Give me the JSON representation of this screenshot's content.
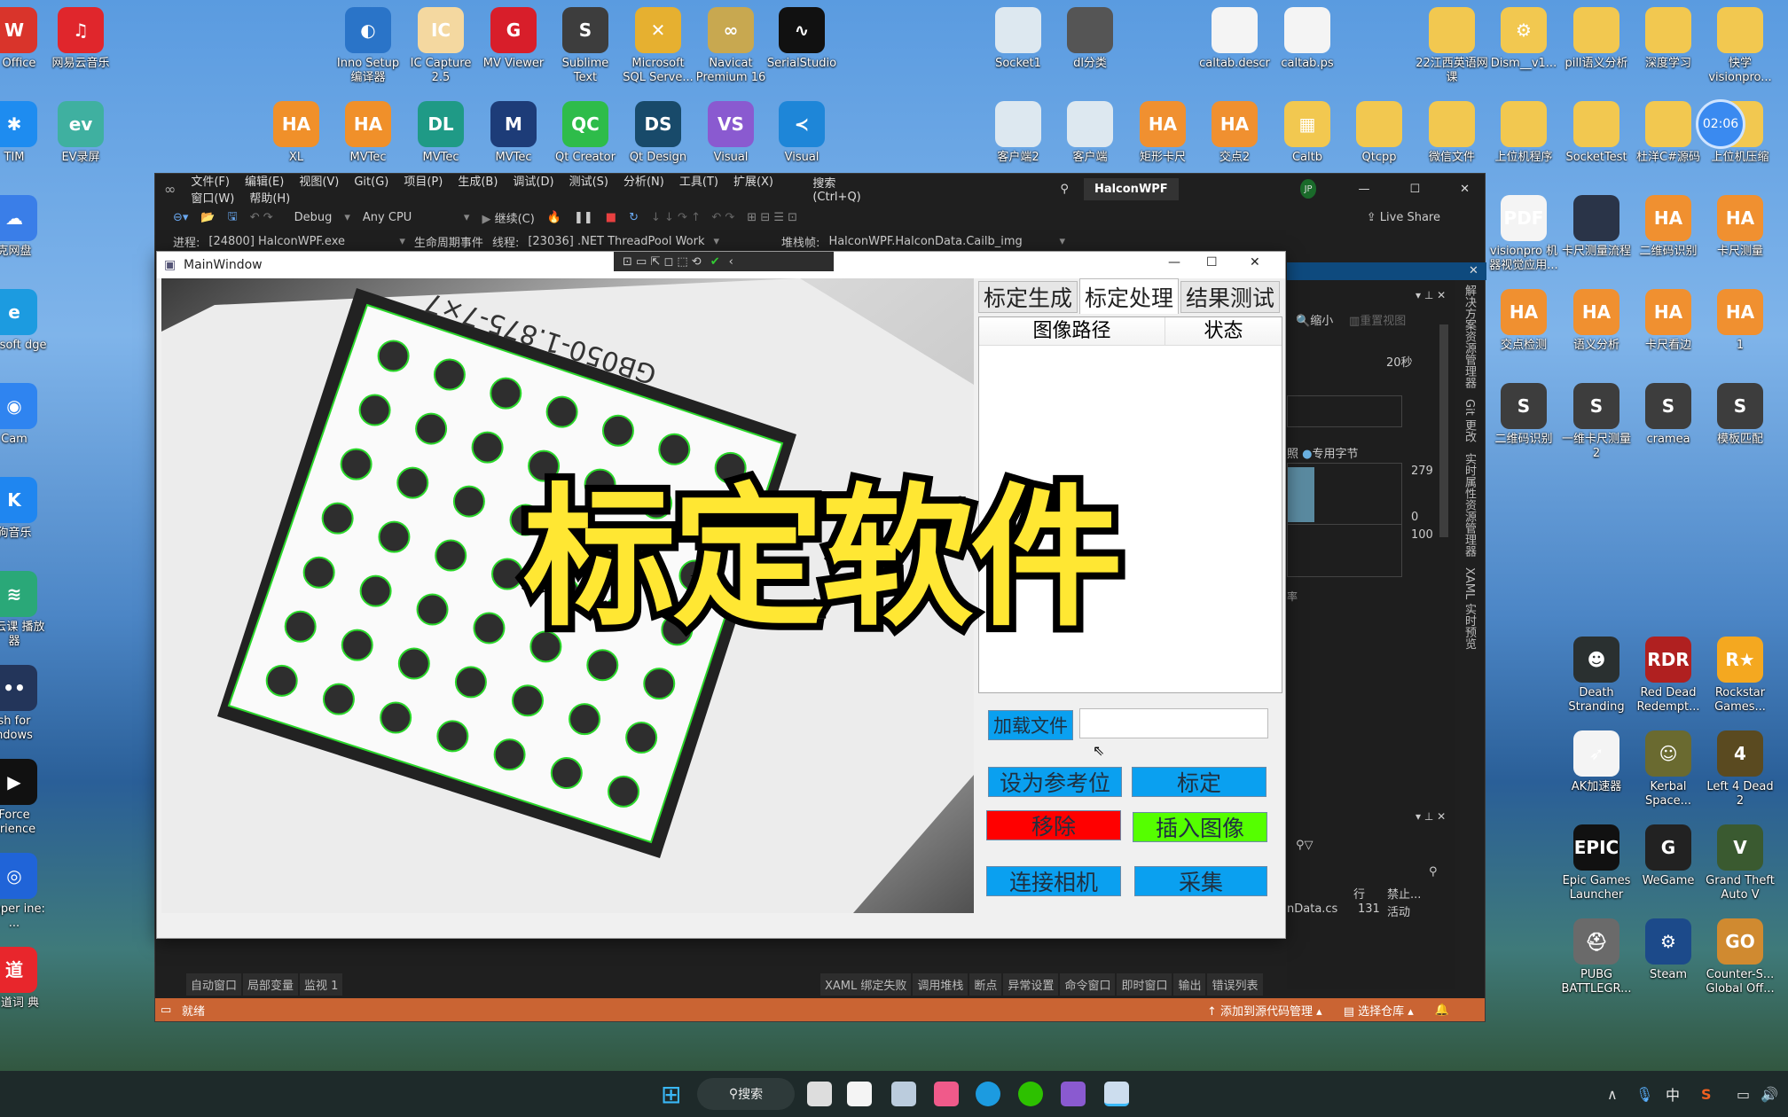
{
  "desktop": {
    "icons": [
      {
        "label": "s Office",
        "color": "#d9342b",
        "glyph": "W"
      },
      {
        "label": "网易云音乐",
        "color": "#e0262c",
        "glyph": "♫"
      },
      {
        "label": "TIM",
        "color": "#1e8cf0",
        "glyph": "✱"
      },
      {
        "label": "EV录屏",
        "color": "#3fb0a0",
        "glyph": "ev"
      },
      {
        "label": "克网盘",
        "color": "#3a7ee8",
        "glyph": "☁"
      },
      {
        "label": "crosoft dge",
        "color": "#1c9be0",
        "glyph": "e"
      },
      {
        "label": "Cam",
        "color": "#2f84f0",
        "glyph": "◉"
      },
      {
        "label": "狗音乐",
        "color": "#1f86f0",
        "glyph": "K"
      },
      {
        "label": "蜂云课 播放器",
        "color": "#2aa878",
        "glyph": "≋"
      },
      {
        "label": "sh for ndows",
        "color": "#23355a",
        "glyph": "••"
      },
      {
        "label": "Force erience",
        "color": "#111",
        "glyph": "▶"
      },
      {
        "label": "lpaper ine: ...",
        "color": "#2064d8",
        "glyph": "◎"
      },
      {
        "label": "有道词 典",
        "color": "#e8262c",
        "glyph": "道"
      },
      {
        "label": "Inno Setup 编译器",
        "color": "#2a74c8",
        "glyph": "◐"
      },
      {
        "label": "IC Capture 2.5",
        "color": "#f4d8a0",
        "glyph": "IC"
      },
      {
        "label": "MV Viewer",
        "color": "#d81e2a",
        "glyph": "G"
      },
      {
        "label": "Sublime Text",
        "color": "#3d3d3d",
        "glyph": "S"
      },
      {
        "label": "Microsoft SQL Serve...",
        "color": "#e6b030",
        "glyph": "✕"
      },
      {
        "label": "Navicat Premium 16",
        "color": "#c8a850",
        "glyph": "∞"
      },
      {
        "label": "SerialStudio",
        "color": "#111",
        "glyph": "∿"
      },
      {
        "label": "XL",
        "color": "#f0902a",
        "glyph": "HA"
      },
      {
        "label": "MVTec",
        "color": "#f0902a",
        "glyph": "HA"
      },
      {
        "label": "MVTec",
        "color": "#1f9a86",
        "glyph": "DL"
      },
      {
        "label": "MVTec",
        "color": "#1d3c78",
        "glyph": "M"
      },
      {
        "label": "Qt Creator",
        "color": "#2ebc4a",
        "glyph": "QC"
      },
      {
        "label": "Qt Design",
        "color": "#184a6a",
        "glyph": "DS"
      },
      {
        "label": "Visual",
        "color": "#8a5ad0",
        "glyph": "VS"
      },
      {
        "label": "Visual",
        "color": "#1e86d8",
        "glyph": "≺"
      },
      {
        "label": "Socket1",
        "color": "#dde8f0",
        "glyph": ""
      },
      {
        "label": "dl分类",
        "color": "#555",
        "glyph": ""
      },
      {
        "label": "caltab.descr",
        "color": "#f4f4f4",
        "glyph": ""
      },
      {
        "label": "caltab.ps",
        "color": "#f4f4f4",
        "glyph": ""
      },
      {
        "label": "22江西英语网课",
        "color": "#f2c850",
        "glyph": ""
      },
      {
        "label": "Dism__v1...",
        "color": "#f2c850",
        "glyph": "⚙"
      },
      {
        "label": "pill语义分析",
        "color": "#f2c850",
        "glyph": ""
      },
      {
        "label": "深度学习",
        "color": "#f2c850",
        "glyph": ""
      },
      {
        "label": "快学 visionpro...",
        "color": "#f2c850",
        "glyph": ""
      },
      {
        "label": "客户端2",
        "color": "#dde8f0",
        "glyph": ""
      },
      {
        "label": "客户端",
        "color": "#dde8f0",
        "glyph": ""
      },
      {
        "label": "矩形卡尺",
        "color": "#f09030",
        "glyph": "HA"
      },
      {
        "label": "交点2",
        "color": "#f09030",
        "glyph": "HA"
      },
      {
        "label": "Caltb",
        "color": "#f2c850",
        "glyph": "▦"
      },
      {
        "label": "Qtcpp",
        "color": "#f2c850",
        "glyph": ""
      },
      {
        "label": "微信文件",
        "color": "#f2c850",
        "glyph": ""
      },
      {
        "label": "上位机程序",
        "color": "#f2c850",
        "glyph": ""
      },
      {
        "label": "SocketTest",
        "color": "#f2c850",
        "glyph": ""
      },
      {
        "label": "杜洋C#源码",
        "color": "#f2c850",
        "glyph": ""
      },
      {
        "label": "上位机压缩",
        "color": "#f2c850",
        "glyph": ""
      },
      {
        "label": "visionpro 机器视觉应用...",
        "color": "#f4f4f4",
        "glyph": "PDF"
      },
      {
        "label": "卡尺测量流程",
        "color": "#2a3448",
        "glyph": ""
      },
      {
        "label": "二维码识别",
        "color": "#f09030",
        "glyph": "HA"
      },
      {
        "label": "卡尺测量",
        "color": "#f09030",
        "glyph": "HA"
      },
      {
        "label": "交点检测",
        "color": "#f09030",
        "glyph": "HA"
      },
      {
        "label": "语义分析",
        "color": "#f09030",
        "glyph": "HA"
      },
      {
        "label": "卡尺看边",
        "color": "#f09030",
        "glyph": "HA"
      },
      {
        "label": "1",
        "color": "#f09030",
        "glyph": "HA"
      },
      {
        "label": "二维码识别",
        "color": "#3d3d3d",
        "glyph": "S"
      },
      {
        "label": "一维卡尺测量2",
        "color": "#3d3d3d",
        "glyph": "S"
      },
      {
        "label": "cramea",
        "color": "#3d3d3d",
        "glyph": "S"
      },
      {
        "label": "模板匹配",
        "color": "#3d3d3d",
        "glyph": "S"
      },
      {
        "label": "Death Stranding",
        "color": "#2a3030",
        "glyph": "☻"
      },
      {
        "label": "Red Dead Redempt...",
        "color": "#b02020",
        "glyph": "RDR"
      },
      {
        "label": "Rockstar Games...",
        "color": "#f4a820",
        "glyph": "R★"
      },
      {
        "label": "AK加速器",
        "color": "#f4f4f4",
        "glyph": "➶"
      },
      {
        "label": "Kerbal Space...",
        "color": "#6a6a30",
        "glyph": "☺"
      },
      {
        "label": "Left 4 Dead 2",
        "color": "#5a4a20",
        "glyph": "4"
      },
      {
        "label": "Epic Games Launcher",
        "color": "#111",
        "glyph": "EPIC"
      },
      {
        "label": "WeGame",
        "color": "#222",
        "glyph": "G"
      },
      {
        "label": "Grand Theft Auto V",
        "color": "#3a5a30",
        "glyph": "V"
      },
      {
        "label": "PUBG BATTLEGR...",
        "color": "#6a6a6a",
        "glyph": "⛑"
      },
      {
        "label": "Steam",
        "color": "#1c4a8a",
        "glyph": "⚙"
      },
      {
        "label": "Counter-S... Global Off...",
        "color": "#d08a30",
        "glyph": "GO"
      }
    ],
    "clock": "02:06"
  },
  "vs": {
    "menu": [
      "文件(F)",
      "编辑(E)",
      "视图(V)",
      "Git(G)",
      "项目(P)",
      "生成(B)",
      "调试(D)",
      "测试(S)",
      "分析(N)",
      "工具(T)",
      "扩展(X)",
      "窗口(W)",
      "帮助(H)"
    ],
    "search": "搜索 (Ctrl+Q)",
    "solution": "HalconWPF",
    "user": "JP",
    "config": "Debug",
    "platform": "Any CPU",
    "continue": "继续(C)",
    "live_share": "Live Share",
    "process_label": "进程:",
    "process": "[24800] HalconWPF.exe",
    "lifecycle": "生命周期事件",
    "thread_label": "线程:",
    "thread": "[23036] .NET ThreadPool Work",
    "stack_label": "堆栈帧:",
    "stack": "HalconWPF.HalconData.Cailb_img",
    "bottom_left_tabs": [
      "自动窗口",
      "局部变量",
      "监视 1"
    ],
    "bottom_right_tabs": [
      "XAML 绑定失败",
      "调用堆栈",
      "断点",
      "异常设置",
      "命令窗口",
      "即时窗口",
      "输出",
      "错误列表"
    ],
    "status": "就绪",
    "add_source": "添加到源代码管理",
    "select_repo": "选择仓库",
    "diag": {
      "zoom_out": "缩小",
      "reset_view": "重置视图",
      "time": "20秒",
      "legend": "专用字节",
      "legend_prefix": "照",
      "max": "279",
      "min": "0",
      "cpu": "100",
      "partial_tab": "率"
    },
    "errors": {
      "col_line": "行",
      "col_suppress": "禁止...",
      "file": "nData.cs",
      "line": "131",
      "state": "活动"
    },
    "side_tabs": [
      "解决方案资源管理器",
      "Git 更改",
      "实时属性资源管理器",
      "XAML 实时预览"
    ]
  },
  "app": {
    "title": "MainWindow",
    "board_label": "GB050-1.875-7×7",
    "tabs": [
      "标定生成",
      "标定处理",
      "结果测试"
    ],
    "active_tab": 1,
    "columns": [
      "图像路径",
      "状态"
    ],
    "load_file": "加载文件",
    "file_path": "",
    "set_reference": "设为参考位",
    "calibrate": "标定",
    "remove": "移除",
    "insert_image": "插入图像",
    "connect_camera": "连接相机",
    "capture": "采集",
    "colors": {
      "blue": "#0aa0f0",
      "red": "#ff0000",
      "green": "#55ff00"
    }
  },
  "overlay": {
    "title": "标定软件"
  },
  "taskbar": {
    "search": "搜索",
    "ime": "中"
  }
}
